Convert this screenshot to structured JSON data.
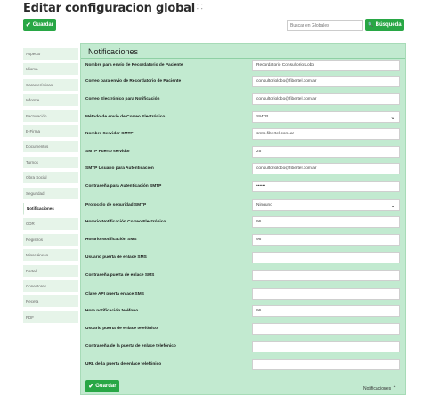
{
  "page": {
    "title": "Editar configuracion global",
    "title_mark": "⸬",
    "save_label": "Guardar",
    "save_icon": "✔",
    "search_placeholder": "Buscar en Globales",
    "search_label": "Búsqueda",
    "search_icon": "🔍"
  },
  "sidebar": {
    "items": [
      {
        "label": "Aspecto",
        "active": false
      },
      {
        "label": "Idioma",
        "active": false
      },
      {
        "label": "Características",
        "active": false
      },
      {
        "label": "Informe",
        "active": false
      },
      {
        "label": "Facturación",
        "active": false
      },
      {
        "label": "E-Firma",
        "active": false
      },
      {
        "label": "Documentos",
        "active": false
      },
      {
        "label": "Turnos",
        "active": false
      },
      {
        "label": "Obra Social",
        "active": false
      },
      {
        "label": "Seguridad",
        "active": false
      },
      {
        "label": "Notificaciones",
        "active": true
      },
      {
        "label": "CDR",
        "active": false
      },
      {
        "label": "Registros",
        "active": false
      },
      {
        "label": "Misceláneos",
        "active": false
      },
      {
        "label": "Portal",
        "active": false
      },
      {
        "label": "Conectores",
        "active": false
      },
      {
        "label": "Receta",
        "active": false
      },
      {
        "label": "PDF",
        "active": false
      }
    ]
  },
  "panel": {
    "title": "Notificaciones",
    "rows": [
      {
        "label": "Nombre para envío de Recordatorio de Paciente",
        "value": "Recordatorio Consultorio Lobo",
        "type": "text"
      },
      {
        "label": "Correo para envío de Recordatorio de Paciente",
        "value": "consultoriolobo@fibertel.com.ar",
        "type": "text"
      },
      {
        "label": "Correo Electrónico para Notificación",
        "value": "consultoriolobo@fibertel.com.ar",
        "type": "text"
      },
      {
        "label": "Método de envío de Correo Electrónico",
        "value": "SMTP",
        "type": "select"
      },
      {
        "label": "Nombre Servidor SMTP",
        "value": "smtp.fibertel.com.ar",
        "type": "text"
      },
      {
        "label": "SMTP Puerto servidor",
        "value": "25",
        "type": "text"
      },
      {
        "label": "SMTP Usuario para Autenticación",
        "value": "consultoriolobo@fibertel.com.ar",
        "type": "text"
      },
      {
        "label": "Contraseña para Autenticación SMTP",
        "value": "••••••",
        "type": "password"
      },
      {
        "label": "Protocolo de seguridad SMTP",
        "value": "Ninguno",
        "type": "select"
      },
      {
        "label": "Horario Notificación Correo Electrónico",
        "value": "96",
        "type": "text"
      },
      {
        "label": "Horario Notificación SMS",
        "value": "96",
        "type": "text"
      },
      {
        "label": "Usuario puerta de enlace SMS",
        "value": "",
        "type": "text"
      },
      {
        "label": "Contraseña puerta de enlace SMS",
        "value": "",
        "type": "text"
      },
      {
        "label": "Clave API puerta enlace SMS",
        "value": "",
        "type": "text"
      },
      {
        "label": "Hora notificación teléfono",
        "value": "96",
        "type": "text"
      },
      {
        "label": "Usuario puerta de enlace telefónico",
        "value": "",
        "type": "text"
      },
      {
        "label": "Contraseña de la puerta de enlace telefónico",
        "value": "",
        "type": "text"
      },
      {
        "label": "URL de la puerta de enlace telefónico",
        "value": "",
        "type": "text"
      }
    ],
    "footer_label": "Notificaciones",
    "footer_icon": "⌃"
  }
}
